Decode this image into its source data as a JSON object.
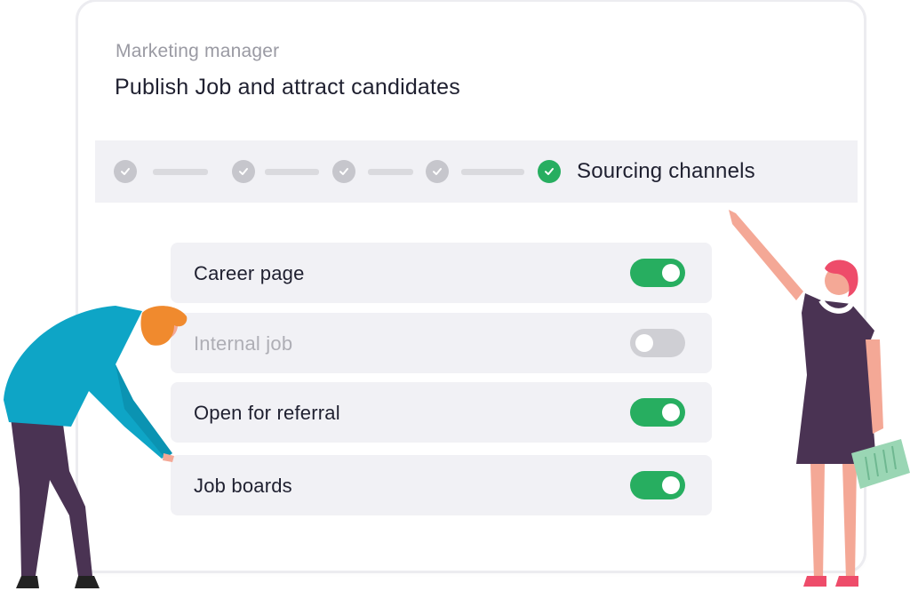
{
  "header": {
    "subtitle": "Marketing manager",
    "title": "Publish Job and attract candidates"
  },
  "stepper": {
    "completed_steps": 4,
    "active_step_label": "Sourcing channels"
  },
  "channels": [
    {
      "label": "Career page",
      "enabled": true,
      "disabled": false
    },
    {
      "label": "Internal job",
      "enabled": false,
      "disabled": true
    },
    {
      "label": "Open for referral",
      "enabled": true,
      "disabled": false
    },
    {
      "label": "Job boards",
      "enabled": true,
      "disabled": false
    }
  ],
  "colors": {
    "accent_green": "#27ae60",
    "toggle_off": "#cfcfd4",
    "row_bg": "#f1f1f5",
    "text_dark": "#1f2030",
    "text_muted": "#9a9aa3"
  },
  "icons": {
    "step_complete": "check-circle-icon",
    "step_active": "check-circle-green-icon"
  }
}
